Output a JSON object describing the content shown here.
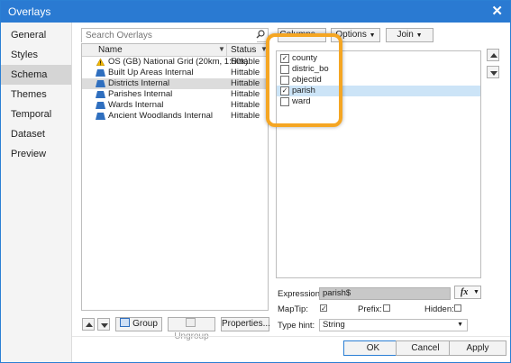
{
  "window": {
    "title": "Overlays",
    "close_symbol": "✕"
  },
  "sidebar": {
    "items": [
      {
        "label": "General"
      },
      {
        "label": "Styles"
      },
      {
        "label": "Schema"
      },
      {
        "label": "Themes"
      },
      {
        "label": "Temporal"
      },
      {
        "label": "Dataset"
      },
      {
        "label": "Preview"
      }
    ],
    "selected": "Schema"
  },
  "search": {
    "placeholder": "Search Overlays",
    "value": ""
  },
  "overlay_list": {
    "headers": {
      "name": "Name",
      "status": "Status"
    },
    "rows": [
      {
        "name": "OS (GB) National Grid (20km, 1:50k)",
        "status": "Hittable",
        "icon": "warning-icon"
      },
      {
        "name": "Built Up Areas Internal",
        "status": "Hittable",
        "icon": "layer-icon"
      },
      {
        "name": "Districts Internal",
        "status": "Hittable",
        "icon": "layer-icon",
        "selected": true
      },
      {
        "name": "Parishes Internal",
        "status": "Hittable",
        "icon": "layer-icon"
      },
      {
        "name": "Wards Internal",
        "status": "Hittable",
        "icon": "layer-icon"
      },
      {
        "name": "Ancient Woodlands Internal",
        "status": "Hittable",
        "icon": "layer-icon"
      }
    ]
  },
  "list_buttons": {
    "group": "Group",
    "ungroup": "Ungroup",
    "properties": "Properties..."
  },
  "top_buttons": {
    "columns": "Columns",
    "options": "Options",
    "join": "Join"
  },
  "fields": [
    {
      "label": "county",
      "checked": true
    },
    {
      "label": "distric_bo",
      "checked": false
    },
    {
      "label": "objectid",
      "checked": false
    },
    {
      "label": "parish",
      "checked": true,
      "selected": true
    },
    {
      "label": "ward",
      "checked": false
    }
  ],
  "expression": {
    "label": "Expression:",
    "value": "parish$",
    "fx": "fx"
  },
  "flags": {
    "maptip_label": "MapTip:",
    "maptip": true,
    "prefix_label": "Prefix:",
    "prefix": false,
    "hidden_label": "Hidden:",
    "hidden": false
  },
  "type_hint": {
    "label": "Type hint:",
    "value": "String"
  },
  "footer": {
    "ok": "OK",
    "cancel": "Cancel",
    "apply": "Apply"
  },
  "colors": {
    "titlebar": "#2a7ad2",
    "highlight": "#f5a623",
    "selected_field": "#cce4f7"
  }
}
